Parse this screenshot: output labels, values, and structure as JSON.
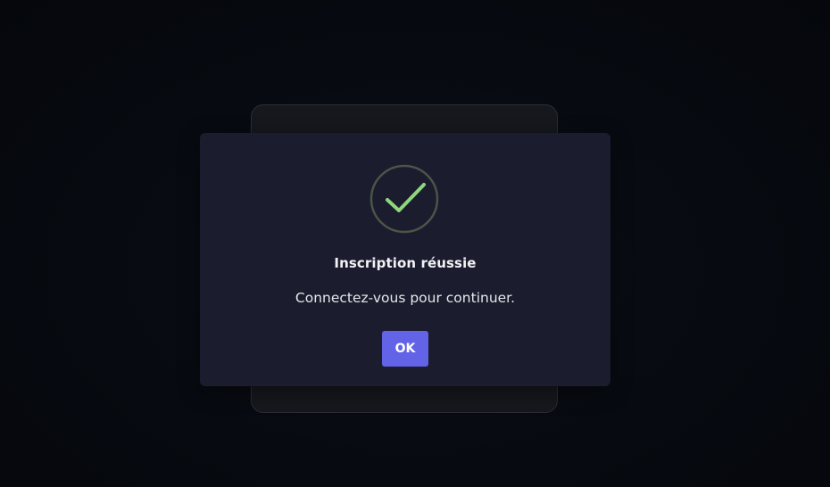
{
  "modal": {
    "icon": "checkmark-success-icon",
    "title": "Inscription réussie",
    "message": "Connectez-vous pour continuer.",
    "ok_label": "OK"
  },
  "colors": {
    "background": "#070a10",
    "backdrop_card": "#16181d",
    "modal_background": "#1b1c2d",
    "success_ring": "#4a5548",
    "success_check": "#8fd67f",
    "button": "#6363e8"
  }
}
